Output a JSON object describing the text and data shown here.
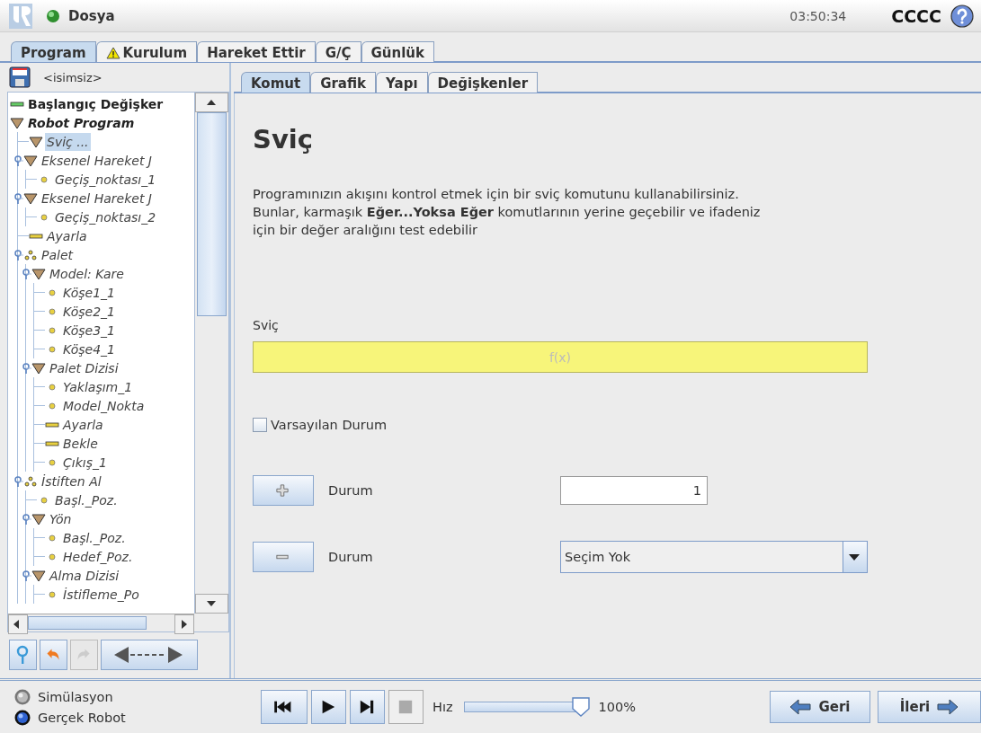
{
  "header": {
    "menu": "Dosya",
    "time": "03:50:34",
    "robot_name": "CCCC"
  },
  "main_tabs": [
    {
      "label": "Program",
      "selected": true,
      "warning": false
    },
    {
      "label": "Kurulum",
      "selected": false,
      "warning": true
    },
    {
      "label": "Hareket Ettir",
      "selected": false,
      "warning": false
    },
    {
      "label": "G/Ç",
      "selected": false,
      "warning": false
    },
    {
      "label": "Günlük",
      "selected": false,
      "warning": false
    }
  ],
  "program": {
    "file_name": "<isimsiz>",
    "tree": [
      {
        "label": "Başlangıç Değişker",
        "kind": "variables",
        "selected": false
      },
      {
        "label": "Robot Program",
        "kind": "program",
        "selected": false,
        "children": [
          {
            "label": "Sviç ...",
            "kind": "folder",
            "selected": true
          },
          {
            "label": "Eksenel Hareket J",
            "kind": "folder",
            "selected": false,
            "expanded": true,
            "children": [
              {
                "label": "Geçiş_noktası_1",
                "kind": "waypoint",
                "selected": false
              }
            ]
          },
          {
            "label": "Eksenel Hareket J",
            "kind": "folder",
            "selected": false,
            "expanded": true,
            "children": [
              {
                "label": "Geçiş_noktası_2",
                "kind": "waypoint",
                "selected": false
              }
            ]
          },
          {
            "label": "Ayarla",
            "kind": "action",
            "selected": false
          },
          {
            "label": "Palet",
            "kind": "pallet",
            "selected": false,
            "expanded": true,
            "children": [
              {
                "label": "Model: Kare",
                "kind": "folder",
                "selected": false,
                "expanded": true,
                "children": [
                  {
                    "label": "Köşe1_1",
                    "kind": "waypoint",
                    "selected": false
                  },
                  {
                    "label": "Köşe2_1",
                    "kind": "waypoint",
                    "selected": false
                  },
                  {
                    "label": "Köşe3_1",
                    "kind": "waypoint",
                    "selected": false
                  },
                  {
                    "label": "Köşe4_1",
                    "kind": "waypoint",
                    "selected": false
                  }
                ]
              },
              {
                "label": "Palet Dizisi",
                "kind": "folder",
                "selected": false,
                "expanded": true,
                "children": [
                  {
                    "label": "Yaklaşım_1",
                    "kind": "waypoint",
                    "selected": false
                  },
                  {
                    "label": "Model_Nokta",
                    "kind": "waypoint",
                    "selected": false
                  },
                  {
                    "label": "Ayarla",
                    "kind": "action",
                    "selected": false
                  },
                  {
                    "label": "Bekle",
                    "kind": "action",
                    "selected": false
                  },
                  {
                    "label": "Çıkış_1",
                    "kind": "waypoint",
                    "selected": false
                  }
                ]
              }
            ]
          },
          {
            "label": "İstiften Al",
            "kind": "pallet",
            "selected": false,
            "expanded": true,
            "children": [
              {
                "label": "Başl._Poz.",
                "kind": "waypoint",
                "selected": false
              },
              {
                "label": "Yön",
                "kind": "folder",
                "selected": false,
                "expanded": true,
                "children": [
                  {
                    "label": "Başl._Poz.",
                    "kind": "waypoint",
                    "selected": false
                  },
                  {
                    "label": "Hedef_Poz.",
                    "kind": "waypoint",
                    "selected": false
                  }
                ]
              },
              {
                "label": "Alma Dizisi",
                "kind": "folder",
                "selected": false,
                "expanded": true,
                "children": [
                  {
                    "label": "İstifleme_Po",
                    "kind": "waypoint",
                    "selected": false
                  }
                ]
              }
            ]
          }
        ]
      }
    ]
  },
  "sub_tabs": [
    {
      "label": "Komut",
      "selected": true
    },
    {
      "label": "Grafik",
      "selected": false
    },
    {
      "label": "Yapı",
      "selected": false
    },
    {
      "label": "Değişkenler",
      "selected": false
    }
  ],
  "command": {
    "title": "Sviç",
    "description": [
      "Programınızın akışını kontrol etmek için bir sviç komutunu kullanabilirsiniz.",
      "Bunlar, karmaşık **Eğer...Yoksa Eğer** komutlarının yerine geçebilir ve ifadeniz",
      "için bir değer aralığını test edebilir"
    ],
    "switch_label": "Sviç",
    "expression_placeholder": "f(x)",
    "default_case": {
      "label": "Varsayılan Durum",
      "checked": false
    },
    "cases": [
      {
        "kind": "add",
        "label": "Durum",
        "value": "1"
      },
      {
        "kind": "remove",
        "label": "Durum",
        "dropdown": "Seçim Yok"
      }
    ]
  },
  "modes": [
    {
      "label": "Simülasyon",
      "selected": false
    },
    {
      "label": "Gerçek Robot",
      "selected": true
    }
  ],
  "playback": {
    "speed_label": "Hız",
    "speed": {
      "level": 1.0
    },
    "speed_reading": "100%"
  },
  "nav": [
    {
      "label": "Geri",
      "kind": "back"
    },
    {
      "label": "İleri",
      "kind": "next"
    }
  ]
}
